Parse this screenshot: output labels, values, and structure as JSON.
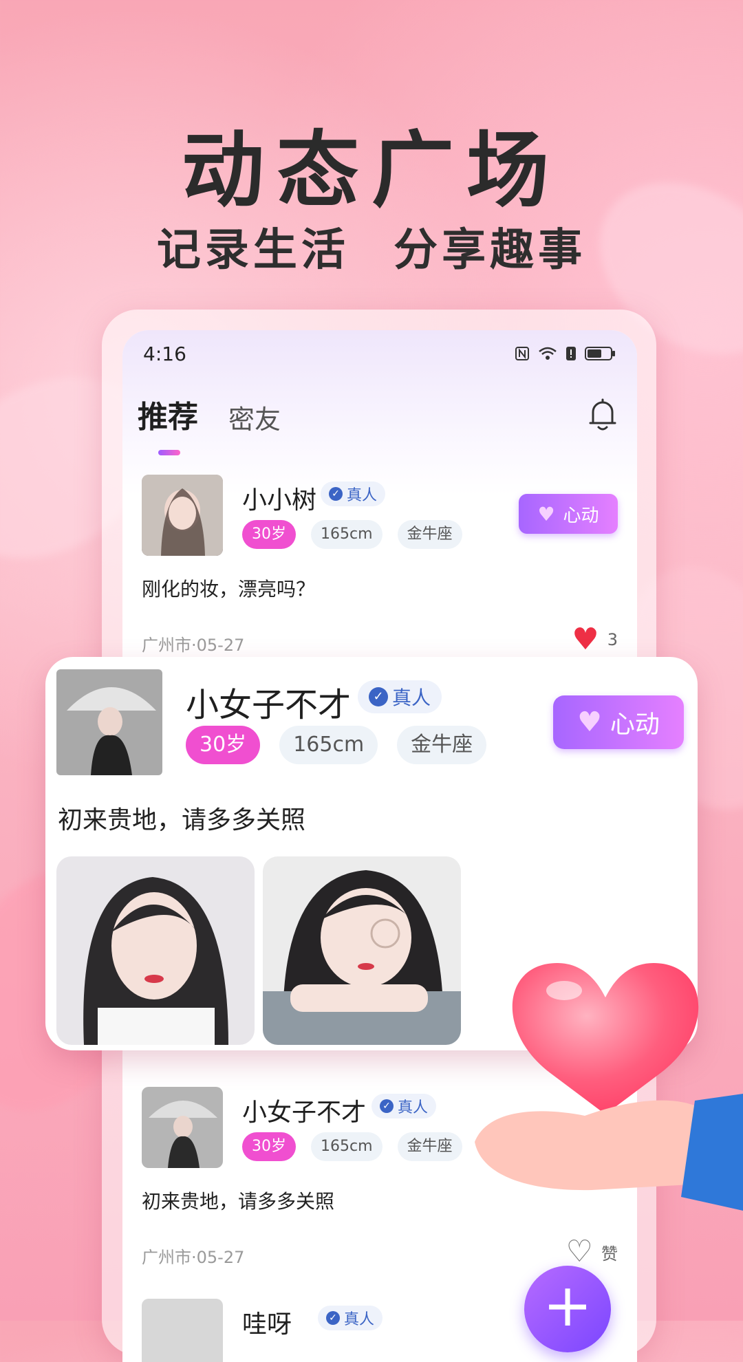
{
  "hero": {
    "title": "动态广场",
    "sub_left": "记录生活",
    "sub_right": "分享趣事"
  },
  "status": {
    "time": "4:16"
  },
  "tabs": {
    "active": "推荐",
    "other": "密友"
  },
  "post1": {
    "name": "小小树",
    "verified": "真人",
    "tags": [
      "30岁",
      "165cm",
      "金牛座"
    ],
    "button": "心动",
    "content": "刚化的妆，漂亮吗？",
    "location_date": "广州市·05-27",
    "likes": "3"
  },
  "featured": {
    "name": "小女子不才",
    "verified": "真人",
    "tags": [
      "30岁",
      "165cm",
      "金牛座"
    ],
    "button": "心动",
    "content": "初来贵地，请多多关照"
  },
  "post2": {
    "name": "小女子不才",
    "verified": "真人",
    "tags": [
      "30岁",
      "165cm",
      "金牛座"
    ],
    "content": "初来贵地，请多多关照",
    "location_date": "广州市·05-27",
    "like_label": "赞"
  },
  "post3": {
    "name": "哇呀",
    "verified": "真人"
  },
  "fab": {
    "label": "+"
  },
  "colors": {
    "accent_purple": "#a766ff",
    "age_pink": "#f04fd0",
    "heart_red": "#ee2f45"
  }
}
